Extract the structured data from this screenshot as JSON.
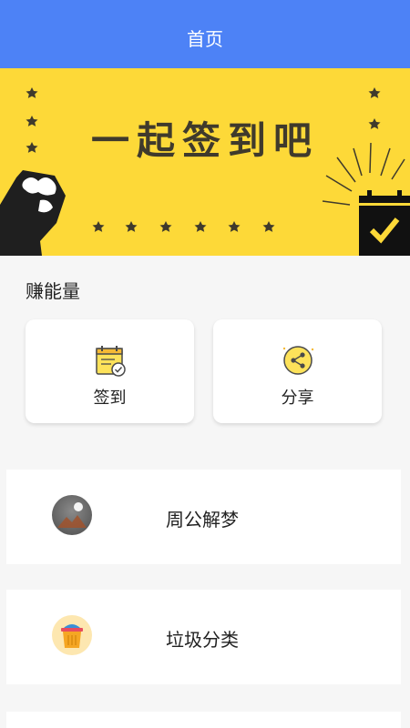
{
  "header": {
    "title": "首页"
  },
  "banner": {
    "headline": "一起签到吧"
  },
  "section": {
    "title": "赚能量"
  },
  "cards": [
    {
      "label": "签到",
      "icon": "calendar-check-icon"
    },
    {
      "label": "分享",
      "icon": "share-icon"
    }
  ],
  "list": [
    {
      "label": "周公解梦",
      "icon": "moon-mountain-icon"
    },
    {
      "label": "垃圾分类",
      "icon": "trash-bin-icon"
    }
  ],
  "colors": {
    "header": "#4d82f6",
    "banner": "#fdd938",
    "text": "#222222"
  }
}
